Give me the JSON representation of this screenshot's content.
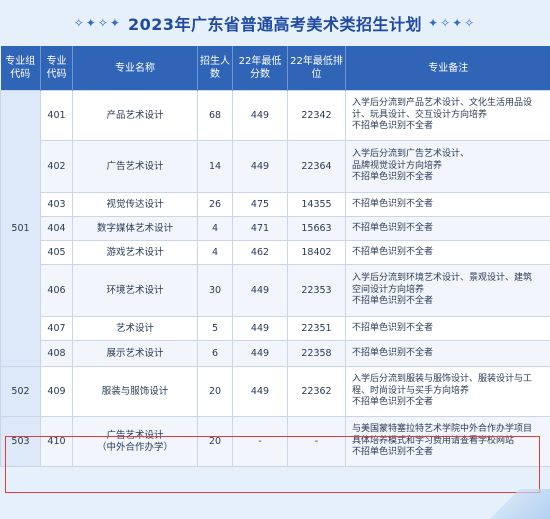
{
  "title": {
    "left_stars": "✧✦✧✦",
    "text": "2023年广东省普通高考美术类招生计划",
    "right_stars": "✦✧✦✧"
  },
  "headers": [
    "专业组代码",
    "专业代码",
    "专业名称",
    "招生人数",
    "22年最低分数",
    "22年最低排位",
    "专业备注"
  ],
  "colors": {
    "header_bg": "#2f64b7",
    "highlight": "#e23b3b",
    "title": "#1f4aa0"
  },
  "groups": [
    {
      "code": "501",
      "rows": [
        {
          "major_code": "401",
          "name": [
            "产品艺术设计"
          ],
          "count": "68",
          "min_score": "449",
          "min_rank": "22342",
          "notes": [
            "入学后分流到产品艺术设计、文化生活用品设",
            "计、玩具设计、交互设计方向培养",
            "不招单色识别不全者"
          ]
        },
        {
          "major_code": "402",
          "name": [
            "广告艺术设计"
          ],
          "count": "14",
          "min_score": "449",
          "min_rank": "22364",
          "notes": [
            "入学后分流到广告艺术设计、",
            "品牌视觉设计方向培养",
            "不招单色识别不全者"
          ]
        },
        {
          "major_code": "403",
          "name": [
            "视觉传达设计"
          ],
          "count": "26",
          "min_score": "475",
          "min_rank": "14355",
          "notes": [
            "不招单色识别不全者"
          ]
        },
        {
          "major_code": "404",
          "name": [
            "数字媒体艺术设计"
          ],
          "count": "4",
          "min_score": "471",
          "min_rank": "15663",
          "notes": [
            "不招单色识别不全者"
          ]
        },
        {
          "major_code": "405",
          "name": [
            "游戏艺术设计"
          ],
          "count": "4",
          "min_score": "462",
          "min_rank": "18402",
          "notes": [
            "不招单色识别不全者"
          ]
        },
        {
          "major_code": "406",
          "name": [
            "环境艺术设计"
          ],
          "count": "30",
          "min_score": "449",
          "min_rank": "22353",
          "notes": [
            "入学后分流到环境艺术设计、景观设计、建筑",
            "空间设计方向培养",
            "不招单色识别不全者"
          ]
        },
        {
          "major_code": "407",
          "name": [
            "艺术设计"
          ],
          "count": "5",
          "min_score": "449",
          "min_rank": "22351",
          "notes": [
            "不招单色识别不全者"
          ]
        },
        {
          "major_code": "408",
          "name": [
            "展示艺术设计"
          ],
          "count": "6",
          "min_score": "449",
          "min_rank": "22358",
          "notes": [
            "不招单色识别不全者"
          ]
        }
      ]
    },
    {
      "code": "502",
      "rows": [
        {
          "major_code": "409",
          "name": [
            "服装与服饰设计"
          ],
          "count": "20",
          "min_score": "449",
          "min_rank": "22362",
          "notes": [
            "入学后分流到服装与服饰设计、服装设计与工",
            "程、时尚设计与买手方向培养",
            "不招单色识别不全者"
          ]
        }
      ]
    },
    {
      "code": "503",
      "rows": [
        {
          "major_code": "410",
          "name": [
            "广告艺术设计",
            "（中外合作办学）"
          ],
          "count": "20",
          "min_score": "-",
          "min_rank": "-",
          "notes": [
            "与美国蒙特塞拉特艺术学院中外合作办学项目",
            "具体培养模式和学习费用请查看学校网站",
            "不招单色识别不全者"
          ]
        }
      ]
    }
  ]
}
